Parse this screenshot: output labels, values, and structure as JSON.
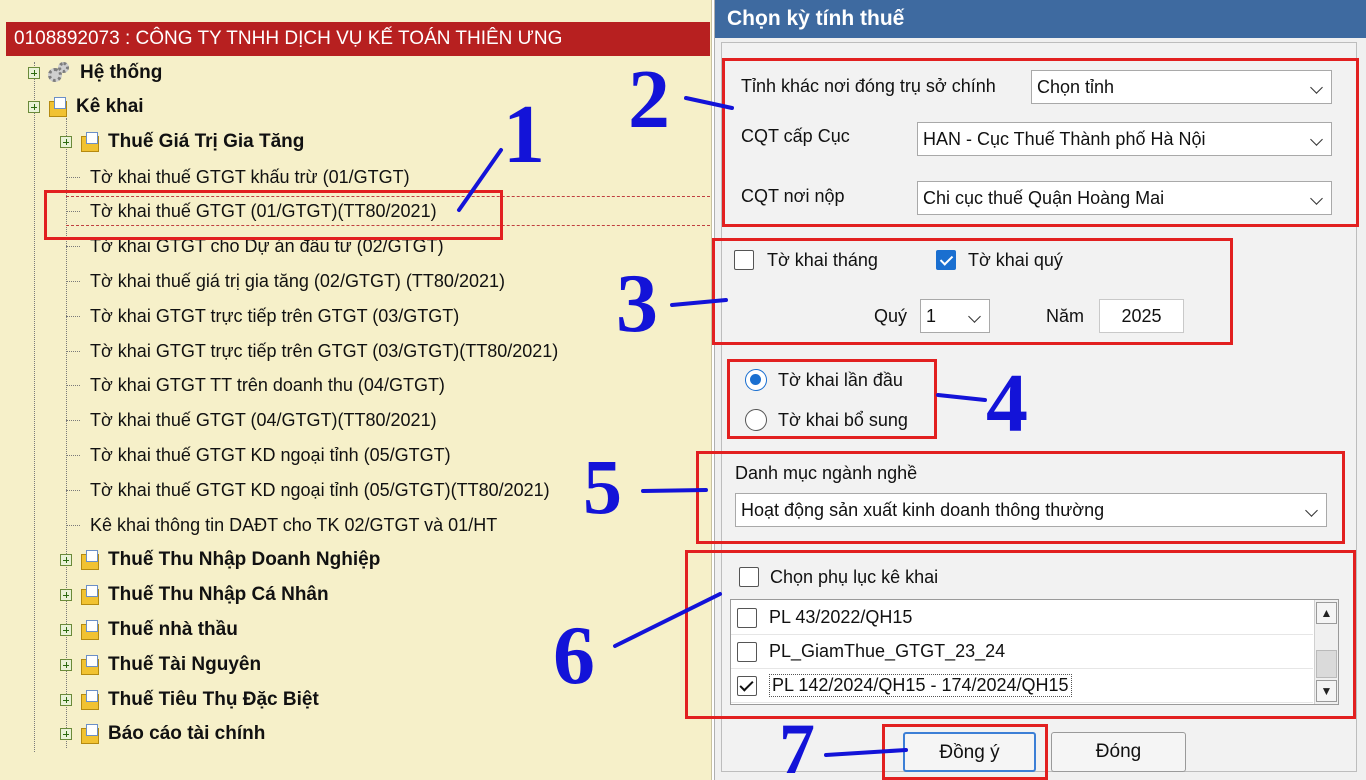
{
  "company_bar": "0108892073 : CÔNG TY TNHH DỊCH VỤ KẾ TOÁN THIÊN ƯNG",
  "tree": {
    "he_thong": "Hệ thống",
    "ke_khai": "Kê khai",
    "gtgt": "Thuế Giá Trị Gia Tăng",
    "leaves": [
      "Tờ khai thuế GTGT khấu trừ (01/GTGT)",
      "Tờ khai thuế GTGT (01/GTGT)(TT80/2021)",
      "Tờ khai GTGT cho Dự án đầu tư (02/GTGT)",
      "Tờ khai thuế giá trị gia tăng (02/GTGT) (TT80/2021)",
      "Tờ khai GTGT trực tiếp trên GTGT (03/GTGT)",
      "Tờ khai GTGT trực tiếp trên GTGT (03/GTGT)(TT80/2021)",
      "Tờ khai GTGT TT trên doanh thu (04/GTGT)",
      "Tờ khai thuế GTGT (04/GTGT)(TT80/2021)",
      "Tờ khai thuế GTGT KD ngoại tỉnh (05/GTGT)",
      "Tờ khai thuế GTGT KD ngoại tỉnh (05/GTGT)(TT80/2021)",
      "Kê khai thông tin DAĐT cho TK 02/GTGT và 01/HT"
    ],
    "groups": [
      "Thuế Thu Nhập Doanh Nghiệp",
      "Thuế Thu Nhập Cá Nhân",
      "Thuế nhà thầu",
      "Thuế Tài Nguyên",
      "Thuế Tiêu Thụ Đặc Biệt",
      "Báo cáo tài chính"
    ]
  },
  "dialog": {
    "title": "Chọn kỳ tính thuế",
    "province_label": "Tỉnh khác nơi đóng trụ sở chính",
    "province_value": "Chọn tỉnh",
    "cqt_cuc_label": "CQT cấp Cục",
    "cqt_cuc_value": "HAN - Cục Thuế Thành phố Hà Nội",
    "cqt_nop_label": "CQT nơi nộp",
    "cqt_nop_value": "Chi cục thuế Quận Hoàng Mai",
    "to_khai_thang": "Tờ khai tháng",
    "to_khai_quy": "Tờ khai quý",
    "quy_label": "Quý",
    "quy_value": "1",
    "nam_label": "Năm",
    "nam_value": "2025",
    "lan_dau": "Tờ khai lần đầu",
    "bo_sung": "Tờ khai bổ sung",
    "nganh_nghe_label": "Danh mục ngành nghề",
    "nganh_nghe_value": "Hoạt động sản xuất kinh doanh thông thường",
    "phu_luc_label": "Chọn phụ lục kê khai",
    "phu_luc_items": [
      "PL 43/2022/QH15",
      "PL_GiamThue_GTGT_23_24",
      "PL 142/2024/QH15 - 174/2024/QH15"
    ],
    "ok": "Đồng ý",
    "close": "Đóng"
  },
  "annotations": [
    "1",
    "2",
    "3",
    "4",
    "5",
    "6",
    "7"
  ],
  "colors": {
    "annotation_red": "#e22020",
    "annotation_blue": "#1313d8",
    "title_bar": "#3e6aa0",
    "company_bar": "#b72020"
  }
}
